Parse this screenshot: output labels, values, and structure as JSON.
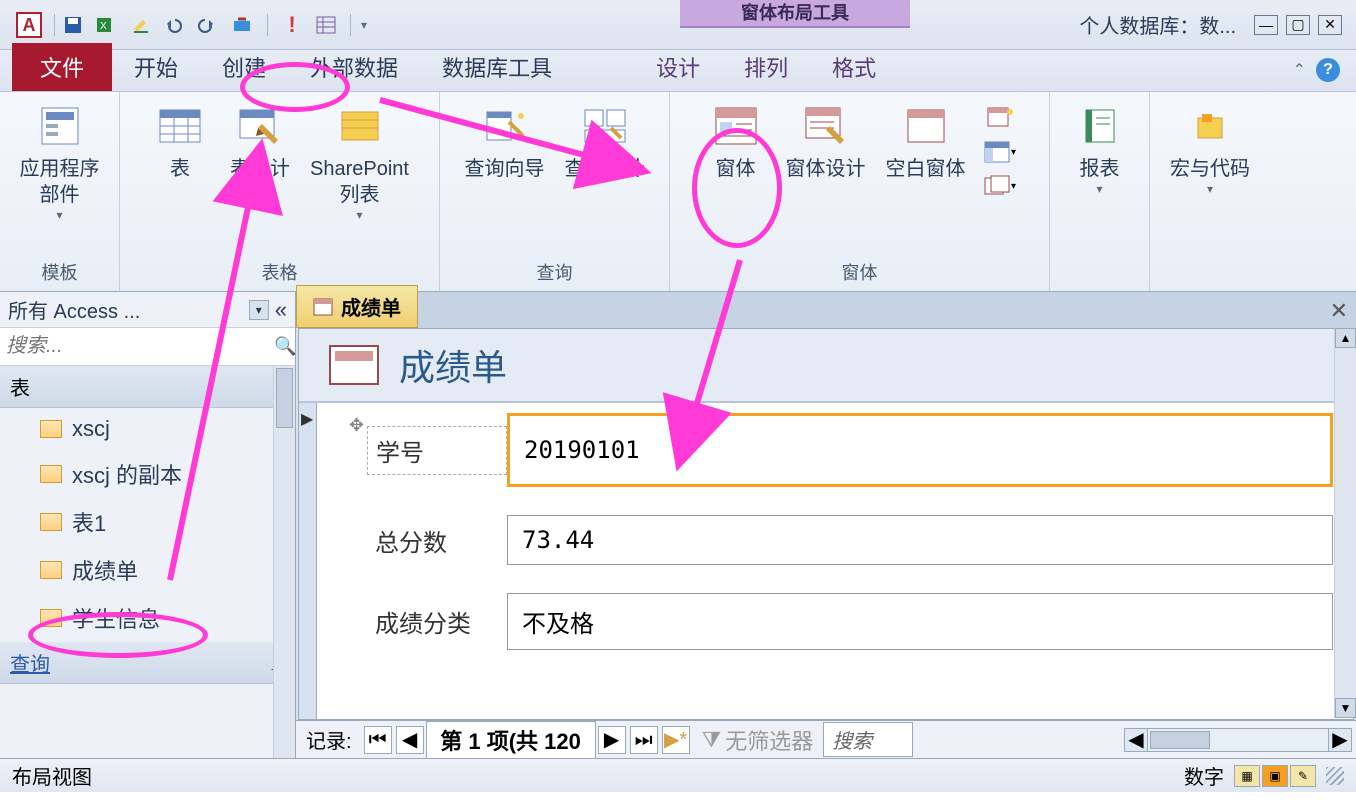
{
  "titlebar": {
    "app_letter": "A",
    "context_title": "窗体布局工具",
    "db_title": "个人数据库：数..."
  },
  "tabs": {
    "file": "文件",
    "home": "开始",
    "create": "创建",
    "external": "外部数据",
    "dbtools": "数据库工具",
    "design": "设计",
    "arrange": "排列",
    "format": "格式"
  },
  "ribbon": {
    "templates": {
      "label": "模板",
      "app_parts": "应用程序\n部件"
    },
    "tables": {
      "label": "表格",
      "table": "表",
      "table_design": "表设计",
      "sharepoint": "SharePoint\n列表"
    },
    "queries": {
      "label": "查询",
      "wizard": "查询向导",
      "design": "查询设计"
    },
    "forms": {
      "label": "窗体",
      "form": "窗体",
      "form_design": "窗体设计",
      "blank": "空白窗体"
    },
    "reports": {
      "label": "",
      "report": "报表"
    },
    "macros": {
      "label": "",
      "macro": "宏与代码"
    }
  },
  "nav": {
    "header": "所有 Access ...",
    "search_placeholder": "搜索...",
    "section_tables": "表",
    "section_queries": "查询",
    "items": [
      {
        "label": "xscj"
      },
      {
        "label": "xscj 的副本"
      },
      {
        "label": "表1"
      },
      {
        "label": "成绩单"
      },
      {
        "label": "学生信息"
      }
    ]
  },
  "doc": {
    "tab_label": "成绩单",
    "form_title": "成绩单",
    "fields": [
      {
        "label": "学号",
        "value": "20190101"
      },
      {
        "label": "总分数",
        "value": "73.44"
      },
      {
        "label": "成绩分类",
        "value": "不及格"
      }
    ]
  },
  "recnav": {
    "label": "记录:",
    "info": "第 1 项(共 120 ",
    "filter": "无筛选器",
    "search": "搜索"
  },
  "statusbar": {
    "view": "布局视图",
    "mode": "数字"
  }
}
